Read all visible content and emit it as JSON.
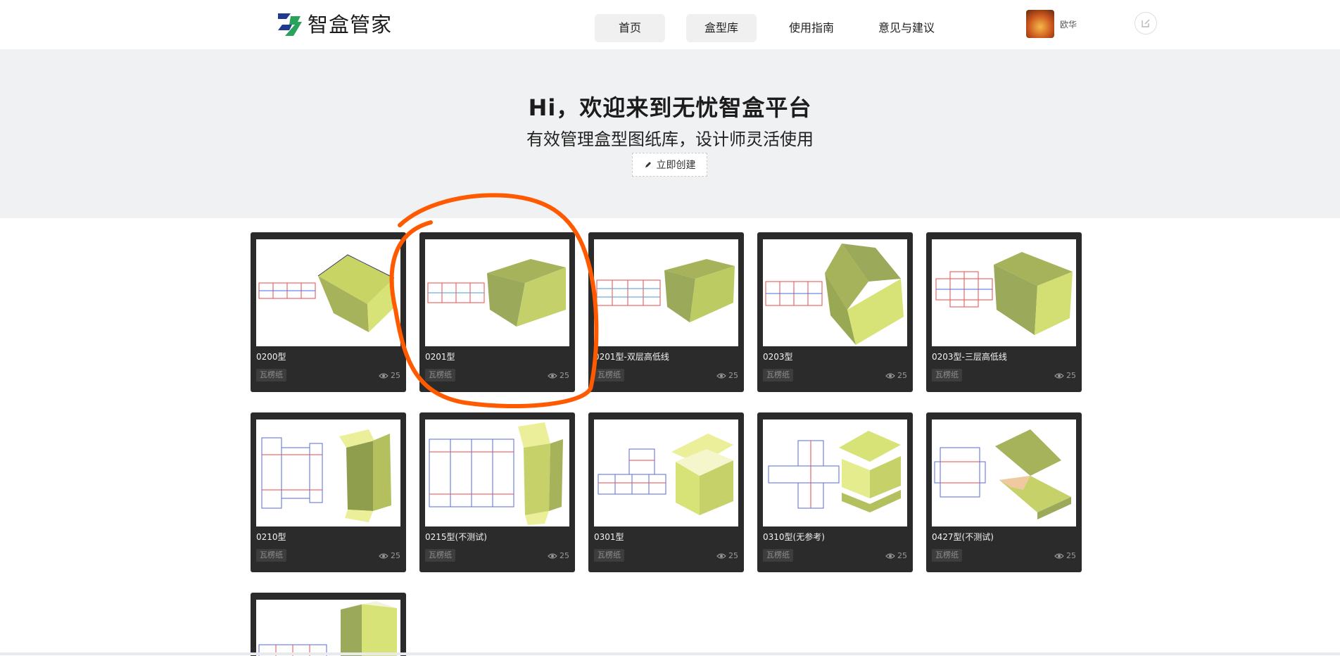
{
  "header": {
    "logo_text": "智盒管家",
    "nav": [
      {
        "label": "首页",
        "active": true
      },
      {
        "label": "盒型库",
        "active": true
      },
      {
        "label": "使用指南",
        "active": false
      },
      {
        "label": "意见与建议",
        "active": false
      }
    ],
    "username": "欧华",
    "edit_icon": "edit-icon"
  },
  "hero": {
    "title": "Hi，欢迎来到无忧智盒平台",
    "subtitle": "有效管理盒型图纸库，设计师灵活使用",
    "create_label": "立即创建"
  },
  "cards": [
    {
      "name": "0200型",
      "tag": "瓦楞纸",
      "views": "25"
    },
    {
      "name": "0201型",
      "tag": "瓦楞纸",
      "views": "25"
    },
    {
      "name": "0201型-双层高低线",
      "tag": "瓦楞纸",
      "views": "25"
    },
    {
      "name": "0203型",
      "tag": "瓦楞纸",
      "views": "25"
    },
    {
      "name": "0203型-三层高低线",
      "tag": "瓦楞纸",
      "views": "25"
    },
    {
      "name": "0210型",
      "tag": "瓦楞纸",
      "views": "25"
    },
    {
      "name": "0215型(不测试)",
      "tag": "瓦楞纸",
      "views": "25"
    },
    {
      "name": "0301型",
      "tag": "瓦楞纸",
      "views": "25"
    },
    {
      "name": "0310型(无参考)",
      "tag": "瓦楞纸",
      "views": "25"
    },
    {
      "name": "0427型(不测试)",
      "tag": "瓦楞纸",
      "views": "25"
    }
  ],
  "colors": {
    "card_bg": "#2b2b2b",
    "hero_bg": "#f0f1f3",
    "box_dark": "#9aa95a",
    "box_light": "#d8e377",
    "annotation": "#ff5a00"
  }
}
